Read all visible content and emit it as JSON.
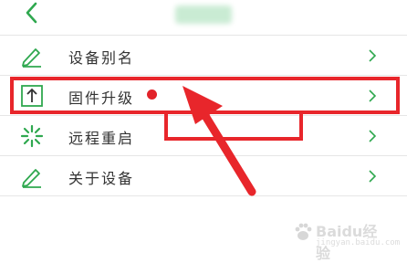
{
  "header": {
    "back_icon": "chevron-left-icon"
  },
  "menu": {
    "items": [
      {
        "label": "设备别名",
        "icon": "pencil-icon",
        "chevron": "chevron-right-icon"
      },
      {
        "label": "固件升级",
        "icon": "upload-arrow-icon",
        "chevron": "chevron-right-icon",
        "badge_color": "#e2232a"
      },
      {
        "label": "远程重启",
        "icon": "spinner-icon",
        "chevron": "chevron-right-icon"
      },
      {
        "label": "关于设备",
        "icon": "pencil-icon",
        "chevron": "chevron-right-icon"
      }
    ]
  },
  "colors": {
    "accent_green": "#2fa84f",
    "highlight_red": "#e8262b",
    "text": "#333333"
  },
  "watermark": {
    "brand": "Baidu经验",
    "sub": "jingyan.baidu.com"
  }
}
